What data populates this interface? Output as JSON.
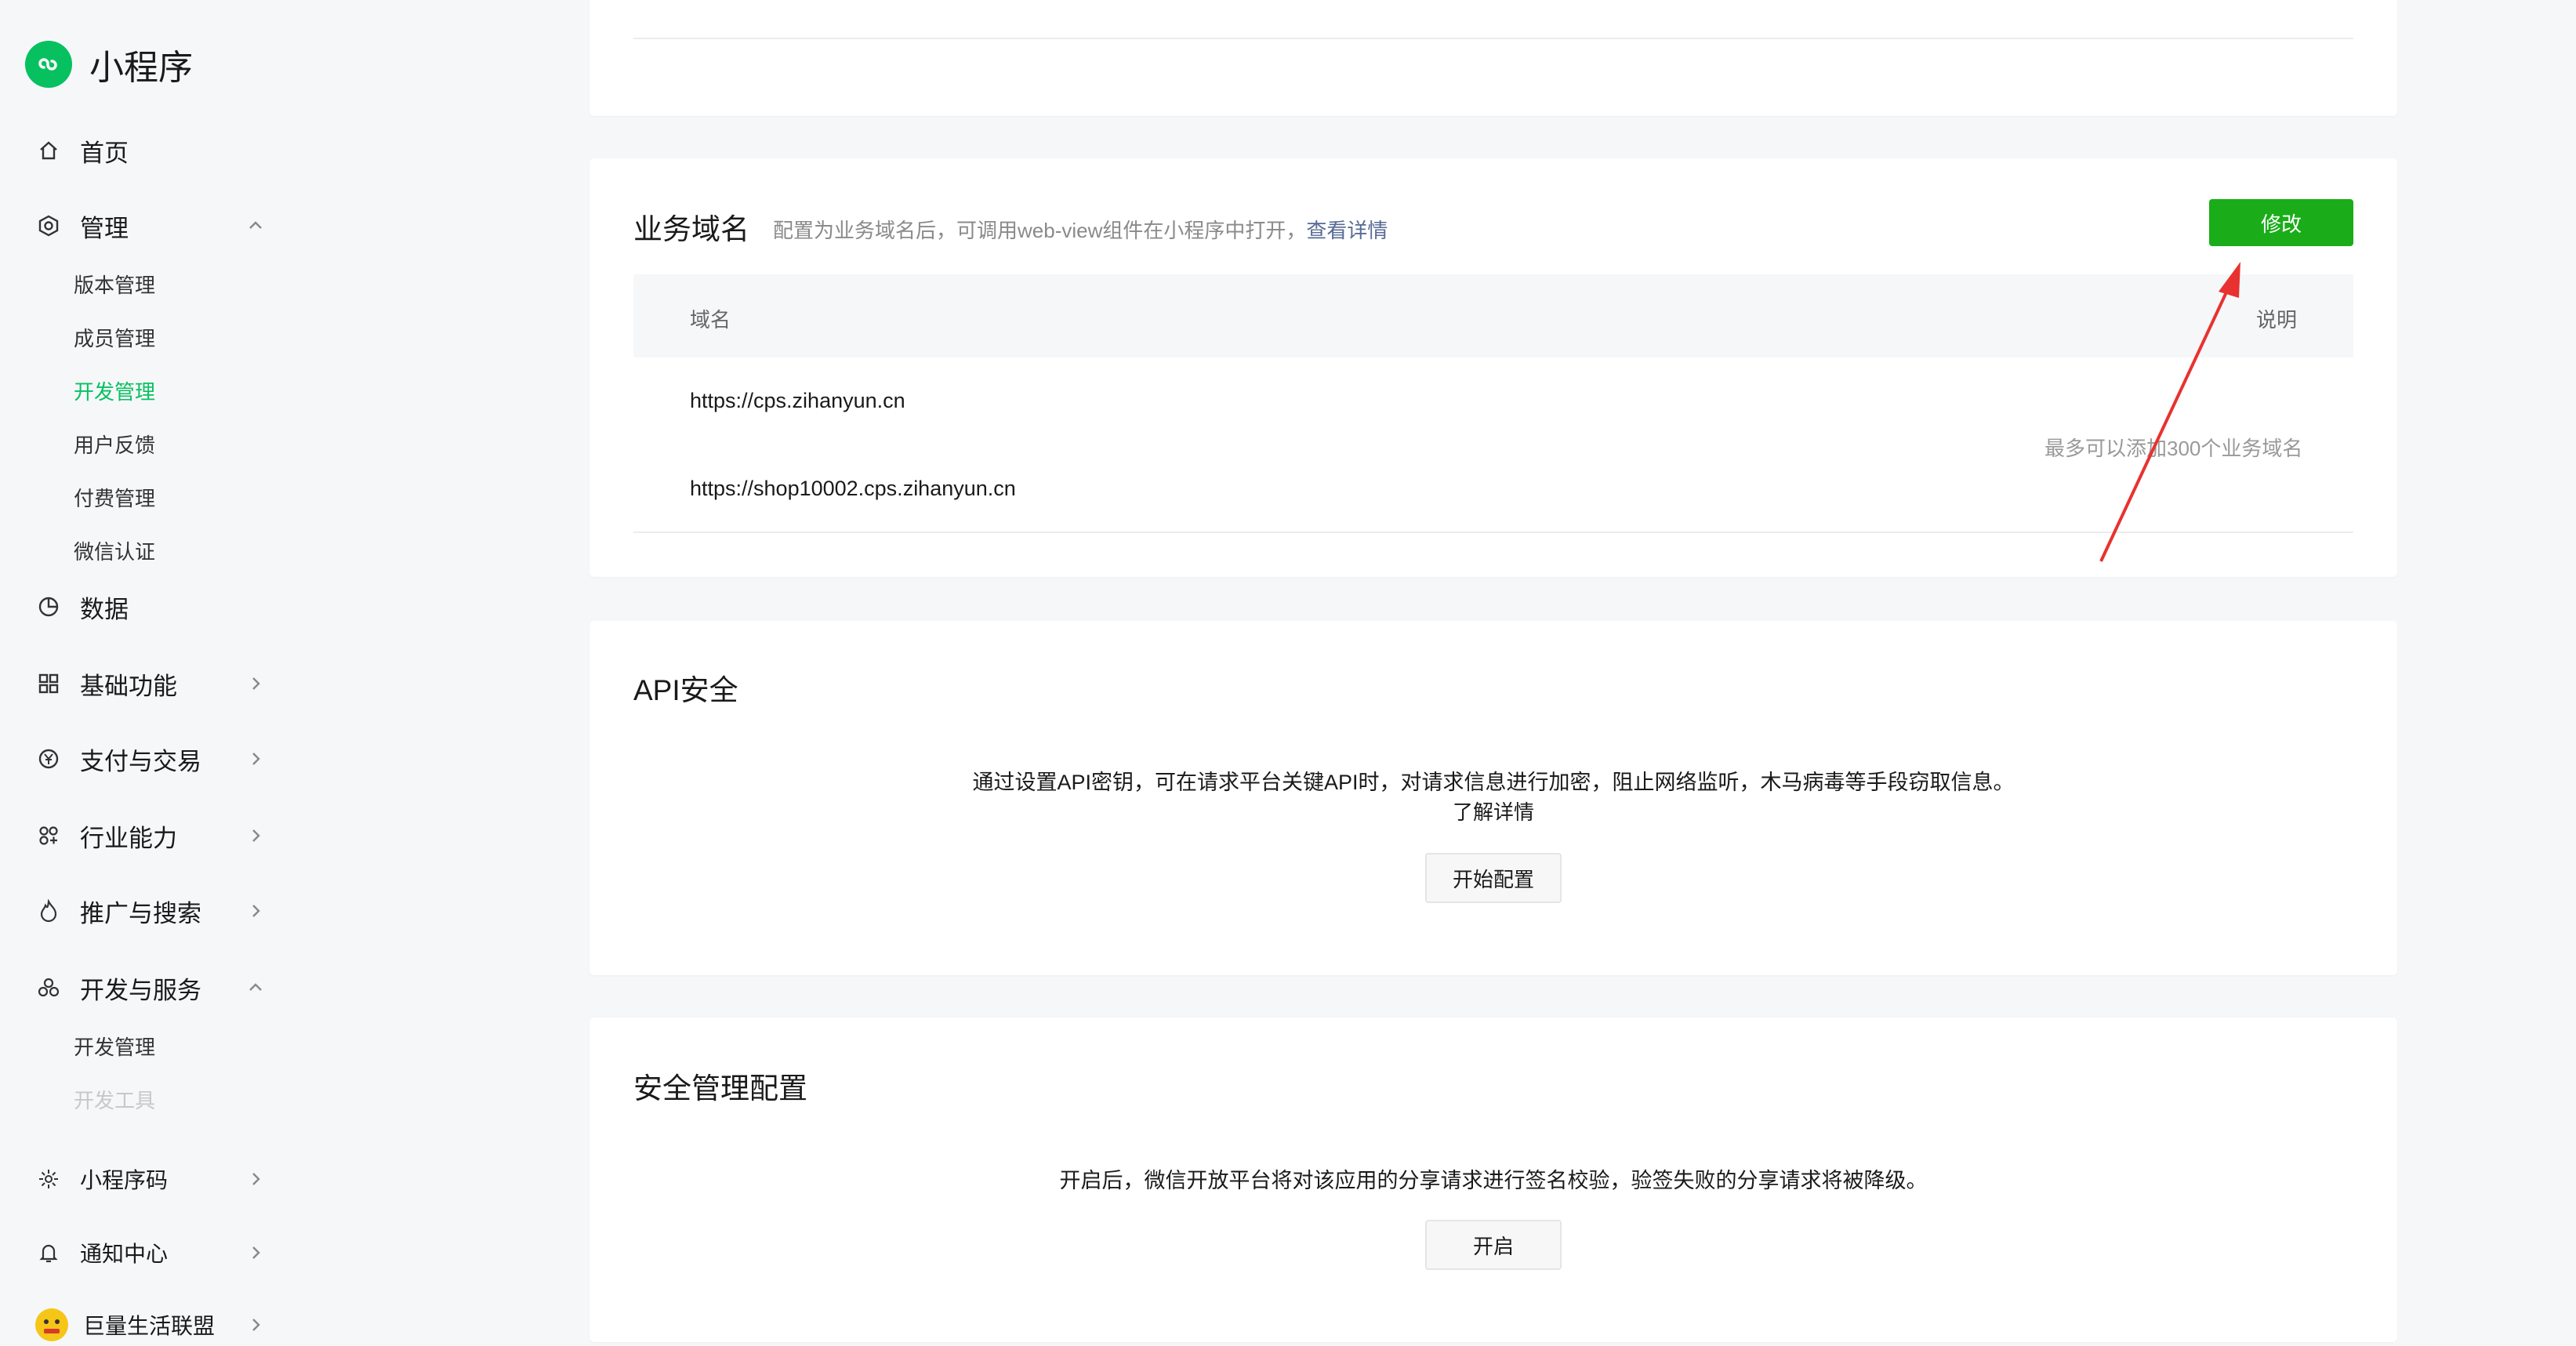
{
  "app": {
    "title": "小程序"
  },
  "sidebar": {
    "items": [
      {
        "label": "首页",
        "icon": "home-icon"
      },
      {
        "label": "管理",
        "icon": "gear-icon",
        "expanded": true,
        "children": [
          "版本管理",
          "成员管理",
          "开发管理",
          "用户反馈",
          "付费管理",
          "微信认证"
        ],
        "active_child": "开发管理"
      },
      {
        "label": "数据",
        "icon": "pie-chart-icon"
      },
      {
        "label": "基础功能",
        "icon": "grid-icon"
      },
      {
        "label": "支付与交易",
        "icon": "yen-icon"
      },
      {
        "label": "行业能力",
        "icon": "industry-icon"
      },
      {
        "label": "推广与搜索",
        "icon": "flame-icon"
      },
      {
        "label": "开发与服务",
        "icon": "cluster-icon",
        "expanded": true,
        "children": [
          "开发管理",
          "开发工具"
        ]
      },
      {
        "label": "小程序码",
        "icon": "sun-icon"
      },
      {
        "label": "通知中心",
        "icon": "bell-icon"
      },
      {
        "label": "巨量生活联盟",
        "icon": "avatar-icon"
      }
    ]
  },
  "business_domain": {
    "title": "业务域名",
    "desc": "配置为业务域名后，可调用web-view组件在小程序中打开，",
    "desc_link": "查看详情",
    "edit_button": "修改",
    "columns": [
      "域名",
      "说明"
    ],
    "rows": [
      "https://cps.zihanyun.cn",
      "https://shop10002.cps.zihanyun.cn"
    ],
    "note": "最多可以添加300个业务域名"
  },
  "api_security": {
    "title": "API安全",
    "desc": "通过设置API密钥，可在请求平台关键API时，对请求信息进行加密，阻止网络监听，木马病毒等手段窃取信息。",
    "link": "了解详情",
    "button": "开始配置"
  },
  "security_config": {
    "title": "安全管理配置",
    "desc": "开启后，微信开放平台将对该应用的分享请求进行签名校验，验签失败的分享请求将被降级。",
    "button": "开启"
  },
  "colors": {
    "brand": "#07c160",
    "primary_button": "#1aad19",
    "link": "#576b95",
    "annotation_arrow": "#e8322f"
  }
}
